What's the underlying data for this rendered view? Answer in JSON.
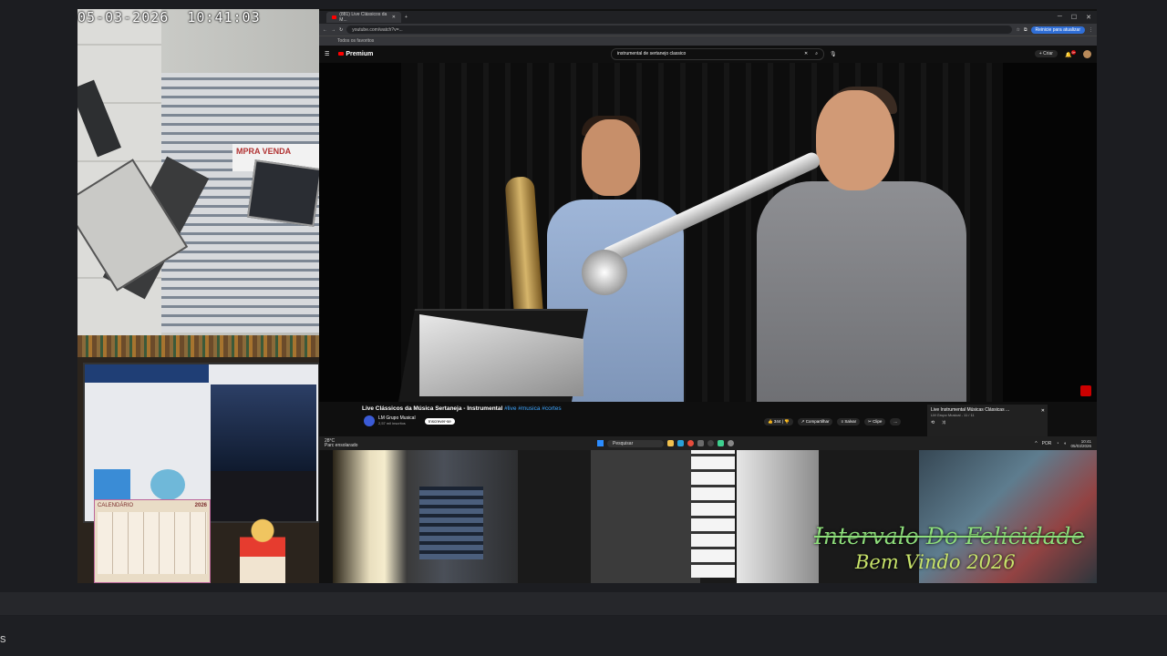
{
  "camera_timestamp": "05-03-2026  10:41:03",
  "cam1": {
    "sign_text": "MPRA  VENDA"
  },
  "browser": {
    "tab_title": "(881) Live Clássicos da M...",
    "url": "youtube.com/watch?v=...",
    "update_button": "Reinicie para atualizar",
    "bookmark": "Todos os favoritos",
    "yt_brand": "Premium",
    "search_value": "instrumental de sertanejo classico",
    "create_label": "Criar",
    "notif_badge": "9+"
  },
  "video": {
    "title": "Live Clássicos da Música Sertaneja - Instrumental",
    "hashtags": "#live #musica #cortes",
    "channel": "LM Grupo Musical",
    "subscribers": "2,57 mil inscritos",
    "subscribe_label": "Inscrever-se",
    "likes": "344",
    "share_label": "Compartilhar",
    "save_label": "Salvar",
    "clip_label": "Clipe",
    "more_label": "..."
  },
  "mini_player": {
    "title": "Live Instrumental Músicas Clássicas ...",
    "channel": "LM Grupo Musical - 11 / 11"
  },
  "taskbar": {
    "weather": "28°C",
    "weather_desc": "Parc ensolarado",
    "search_placeholder": "Pesquisar",
    "lang": "POR",
    "time": "10:41",
    "date": "05/03/2026"
  },
  "calendar": {
    "title": "CALENDÁRIO",
    "year": "2026"
  },
  "overlay": {
    "line1": "Intervalo Do Felicidade",
    "line2": "Bem Vindo 2026"
  },
  "bottom_bar": {
    "edge_text": "s"
  }
}
